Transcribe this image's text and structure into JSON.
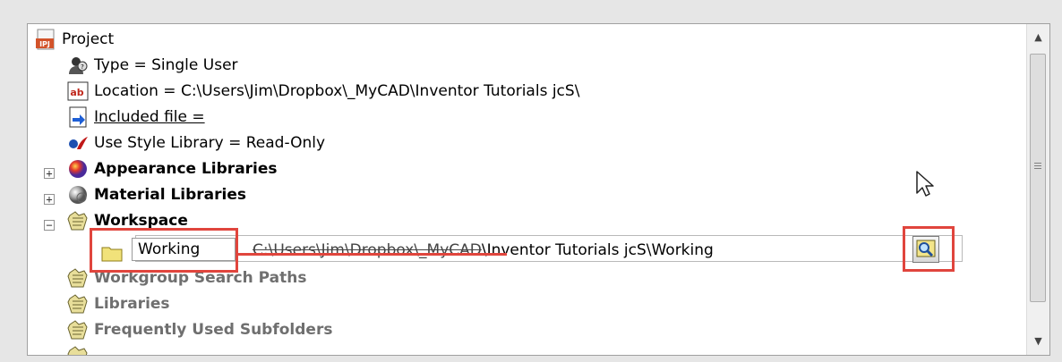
{
  "tree": {
    "project": {
      "label": "Project",
      "icon": "ipj-file-icon",
      "icon_text": "IPJ"
    },
    "type_row": {
      "label": "Type = Single User",
      "icon": "user-type-icon"
    },
    "location_row": {
      "label": "Location = C:\\Users\\Jim\\Dropbox\\_MyCAD\\Inventor Tutorials jcS\\",
      "icon": "text-field-icon",
      "icon_text": "ab"
    },
    "included_row": {
      "label": "Included file =",
      "icon": "included-file-icon"
    },
    "style_row": {
      "label": "Use Style Library = Read-Only",
      "icon": "style-library-icon"
    },
    "appearance": {
      "label": "Appearance Libraries",
      "expander": "+",
      "icon": "appearance-sphere-icon"
    },
    "material": {
      "label": "Material Libraries",
      "expander": "+",
      "icon": "material-sphere-icon"
    },
    "workspace": {
      "label": "Workspace",
      "expander": "−",
      "icon": "folder-paths-icon"
    },
    "workspace_entry": {
      "name_value": "Working",
      "path_struck": "C:\\Users\\Jim\\Dropbox\\_MyCAD",
      "path_rest": "\\Inventor Tutorials jcS\\Working",
      "icon": "folder-icon",
      "browse_icon": "browse-folder-icon"
    },
    "workgroup": {
      "label": "Workgroup Search Paths",
      "icon": "folder-paths-icon"
    },
    "libraries": {
      "label": "Libraries",
      "icon": "folder-paths-icon"
    },
    "frequent": {
      "label": "Frequently Used Subfolders",
      "icon": "folder-paths-icon"
    }
  },
  "scrollbar": {
    "up": "▲",
    "down": "▼"
  },
  "colors": {
    "highlight": "#e0453d",
    "background": "#e6e6e6",
    "panel": "#ffffff",
    "disabled_text": "#6f6f6f"
  }
}
